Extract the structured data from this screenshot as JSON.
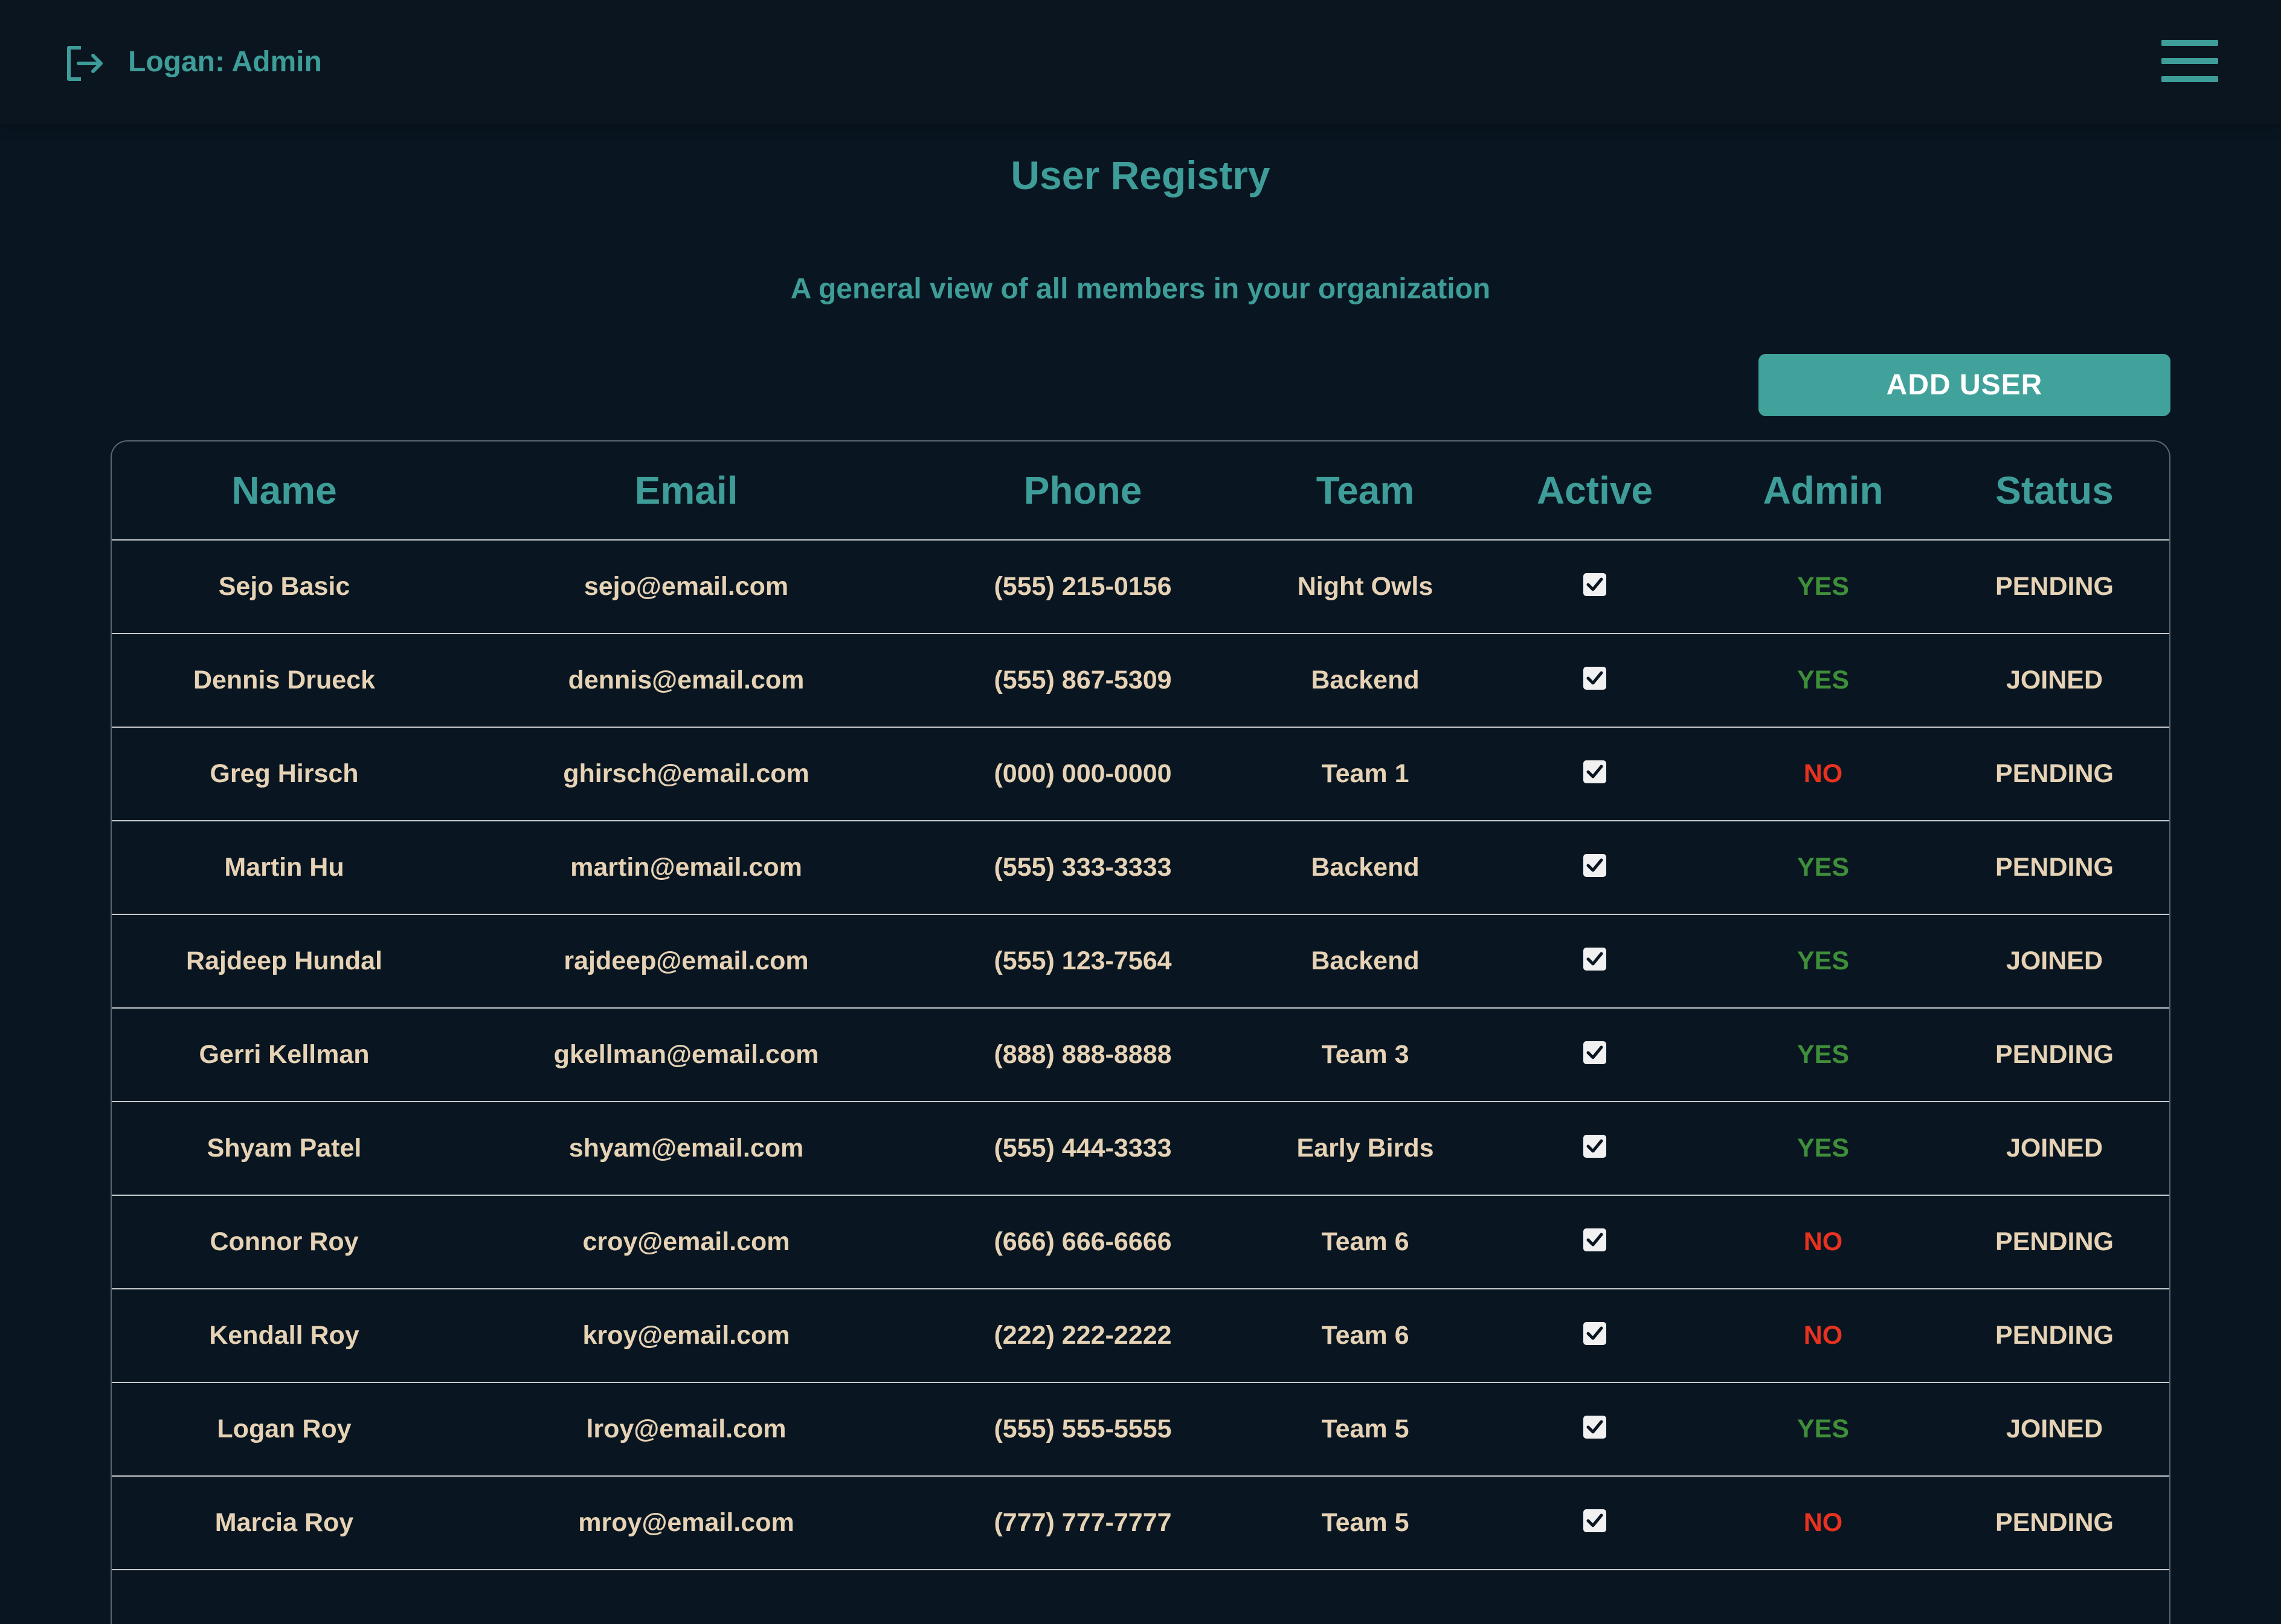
{
  "header": {
    "user_label": "Logan: Admin",
    "logout_icon": "logout-icon",
    "menu_icon": "hamburger-menu-icon"
  },
  "page": {
    "title": "User Registry",
    "subtitle": "A general view of all members in your organization",
    "add_user_label": "ADD USER"
  },
  "colors": {
    "background": "#091621",
    "accent": "#3e9d98",
    "button": "#41a19b",
    "cell_text": "#e6d2b5",
    "admin_yes": "#3f8e3a",
    "admin_no": "#e8321f"
  },
  "table": {
    "columns": [
      "Name",
      "Email",
      "Phone",
      "Team",
      "Active",
      "Admin",
      "Status"
    ],
    "rows": [
      {
        "name": "Sejo Basic",
        "email": "sejo@email.com",
        "phone": "(555) 215-0156",
        "team": "Night Owls",
        "active": true,
        "admin": "YES",
        "status": "PENDING"
      },
      {
        "name": "Dennis Drueck",
        "email": "dennis@email.com",
        "phone": "(555) 867-5309",
        "team": "Backend",
        "active": true,
        "admin": "YES",
        "status": "JOINED"
      },
      {
        "name": "Greg Hirsch",
        "email": "ghirsch@email.com",
        "phone": "(000) 000-0000",
        "team": "Team 1",
        "active": true,
        "admin": "NO",
        "status": "PENDING"
      },
      {
        "name": "Martin Hu",
        "email": "martin@email.com",
        "phone": "(555) 333-3333",
        "team": "Backend",
        "active": true,
        "admin": "YES",
        "status": "PENDING"
      },
      {
        "name": "Rajdeep Hundal",
        "email": "rajdeep@email.com",
        "phone": "(555) 123-7564",
        "team": "Backend",
        "active": true,
        "admin": "YES",
        "status": "JOINED"
      },
      {
        "name": "Gerri Kellman",
        "email": "gkellman@email.com",
        "phone": "(888) 888-8888",
        "team": "Team 3",
        "active": true,
        "admin": "YES",
        "status": "PENDING"
      },
      {
        "name": "Shyam Patel",
        "email": "shyam@email.com",
        "phone": "(555) 444-3333",
        "team": "Early Birds",
        "active": true,
        "admin": "YES",
        "status": "JOINED"
      },
      {
        "name": "Connor Roy",
        "email": "croy@email.com",
        "phone": "(666) 666-6666",
        "team": "Team 6",
        "active": true,
        "admin": "NO",
        "status": "PENDING"
      },
      {
        "name": "Kendall Roy",
        "email": "kroy@email.com",
        "phone": "(222) 222-2222",
        "team": "Team 6",
        "active": true,
        "admin": "NO",
        "status": "PENDING"
      },
      {
        "name": "Logan Roy",
        "email": "lroy@email.com",
        "phone": "(555) 555-5555",
        "team": "Team 5",
        "active": true,
        "admin": "YES",
        "status": "JOINED"
      },
      {
        "name": "Marcia Roy",
        "email": "mroy@email.com",
        "phone": "(777) 777-7777",
        "team": "Team 5",
        "active": true,
        "admin": "NO",
        "status": "PENDING"
      }
    ]
  }
}
